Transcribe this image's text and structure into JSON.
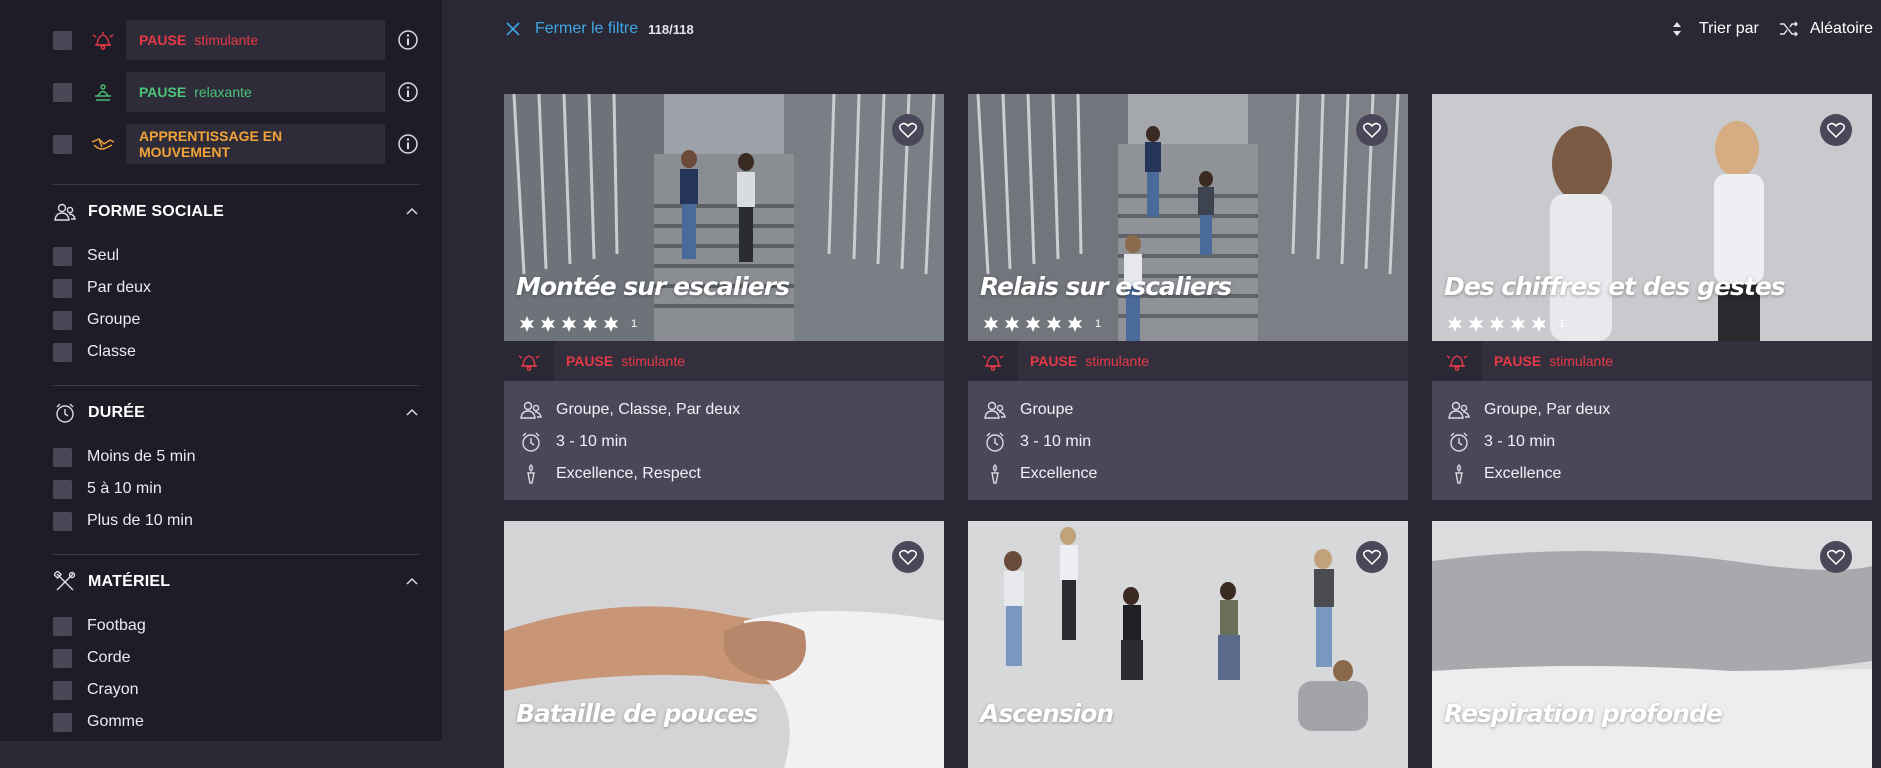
{
  "sidebar": {
    "categories": [
      {
        "bold": "PAUSE",
        "rest": "stimulante",
        "color": "#e63946",
        "icon": "bell-icon"
      },
      {
        "bold": "PAUSE",
        "rest": "relaxante",
        "color": "#4cc47a",
        "icon": "relax-icon"
      },
      {
        "bold": "APPRENTISSAGE EN MOUVEMENT",
        "rest": "",
        "color": "#f2a33a",
        "icon": "learning-icon"
      }
    ],
    "sections": {
      "social": {
        "title": "FORME SOCIALE",
        "options": [
          "Seul",
          "Par deux",
          "Groupe",
          "Classe"
        ]
      },
      "duration": {
        "title": "DURÉE",
        "options": [
          "Moins de 5 min",
          "5 à 10 min",
          "Plus de 10 min"
        ]
      },
      "material": {
        "title": "MATÉRIEL",
        "options": [
          "Footbag",
          "Corde",
          "Crayon",
          "Gomme"
        ]
      }
    }
  },
  "topbar": {
    "close_filter": "Fermer le filtre",
    "count": "118/118",
    "sort_label": "Trier par",
    "random_label": "Aléatoire"
  },
  "cards": [
    {
      "title": "Montée sur escaliers",
      "rating_count": "1",
      "cat_bold": "PAUSE",
      "cat_rest": "stimulante",
      "social": "Groupe, Classe, Par deux",
      "duration": "3 - 10 min",
      "values": "Excellence, Respect"
    },
    {
      "title": "Relais sur escaliers",
      "rating_count": "1",
      "cat_bold": "PAUSE",
      "cat_rest": "stimulante",
      "social": "Groupe",
      "duration": "3 - 10 min",
      "values": "Excellence"
    },
    {
      "title": "Des chiffres et des gestes",
      "rating_count": "1",
      "cat_bold": "PAUSE",
      "cat_rest": "stimulante",
      "social": "Groupe, Par deux",
      "duration": "3 - 10 min",
      "values": "Excellence"
    },
    {
      "title": "Bataille de pouces"
    },
    {
      "title": "Ascension"
    },
    {
      "title": "Respiration profonde"
    }
  ]
}
